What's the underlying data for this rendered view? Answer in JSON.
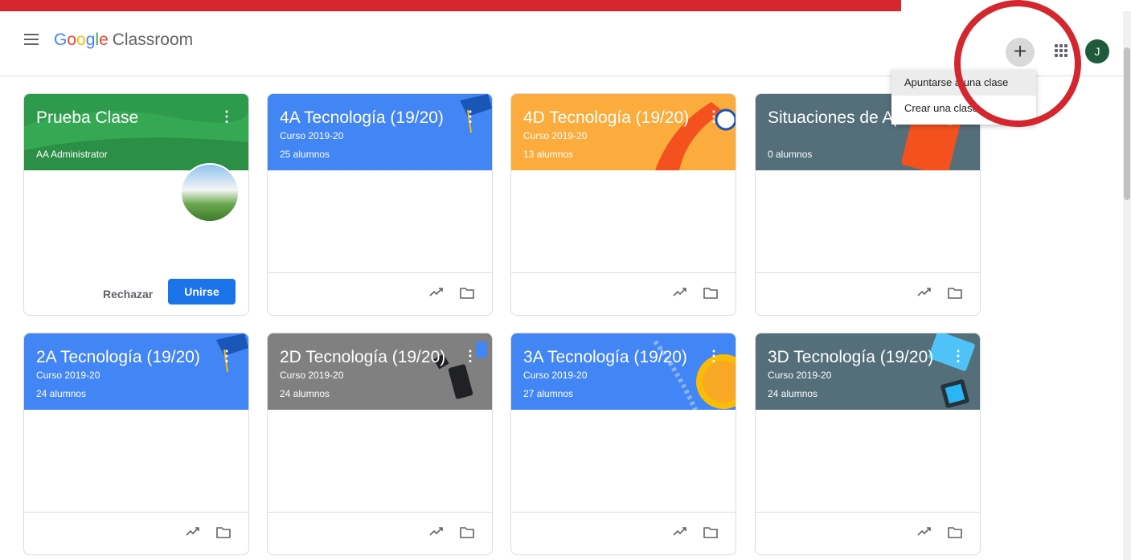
{
  "header": {
    "logo_google": [
      "G",
      "o",
      "o",
      "g",
      "l",
      "e"
    ],
    "logo_colors": [
      "#4285f4",
      "#ea4335",
      "#fbbc05",
      "#4285f4",
      "#34a853",
      "#ea4335"
    ],
    "logo_product": "Classroom",
    "plus_label": "+",
    "avatar_letter": "J"
  },
  "menu": {
    "items": [
      "Apuntarse a una clase",
      "Crear una clase"
    ]
  },
  "cards": [
    {
      "title": "Prueba Clase",
      "subtitle": "AA Administrator",
      "count": "",
      "color": "#34a853",
      "reject": "Rechazar",
      "join": "Unirse"
    },
    {
      "title": "4A Tecnología (19/20)",
      "subtitle": "Curso 2019-20",
      "count": "25 alumnos",
      "color": "#4285f4"
    },
    {
      "title": "4D Tecnología (19/20)",
      "subtitle": "Curso 2019-20",
      "count": "13 alumnos",
      "color": "#fbac3c"
    },
    {
      "title": "Situaciones de Ap",
      "subtitle": "",
      "count": "0 alumnos",
      "color": "#546e7a"
    },
    {
      "title": "2A Tecnología (19/20)",
      "subtitle": "Curso 2019-20",
      "count": "24 alumnos",
      "color": "#4285f4"
    },
    {
      "title": "2D Tecnología (19/20)",
      "subtitle": "Curso 2019-20",
      "count": "24 alumnos",
      "color": "#808080"
    },
    {
      "title": "3A Tecnología (19/20)",
      "subtitle": "Curso 2019-20",
      "count": "27 alumnos",
      "color": "#4285f4"
    },
    {
      "title": "3D Tecnología (19/20)",
      "subtitle": "Curso 2019-20",
      "count": "24 alumnos",
      "color": "#546e7a"
    }
  ]
}
